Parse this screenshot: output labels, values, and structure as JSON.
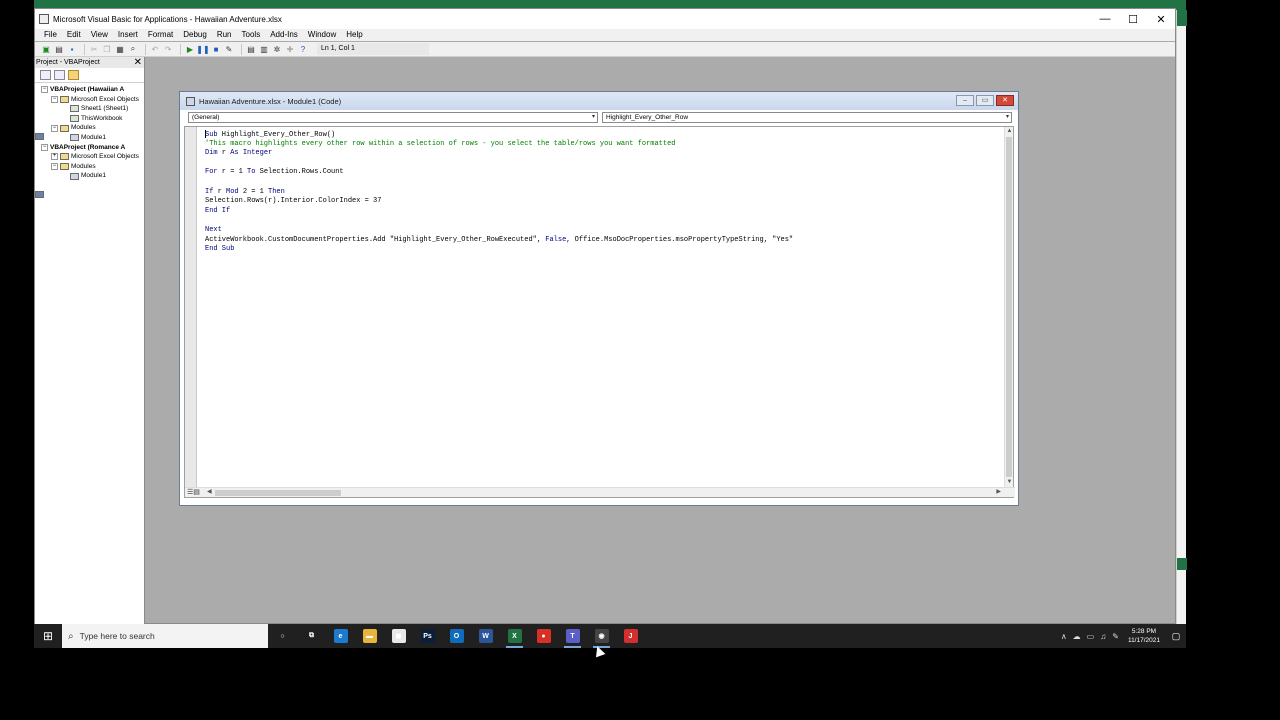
{
  "window": {
    "title": "Microsoft Visual Basic for Applications - Hawaiian Adventure.xlsx",
    "minimize": "—",
    "maximize": "☐",
    "close": "✕"
  },
  "menu": [
    "File",
    "Edit",
    "View",
    "Insert",
    "Format",
    "Debug",
    "Run",
    "Tools",
    "Add-Ins",
    "Window",
    "Help"
  ],
  "toolbar": {
    "position": "Ln 1, Col 1"
  },
  "project": {
    "header": "Project - VBAProject",
    "close": "✕",
    "tree": [
      {
        "label": "VBAProject (Hawaiian A",
        "bold": true,
        "level": 0,
        "icon": "project-icon",
        "exp": "−"
      },
      {
        "label": "Microsoft Excel Objects",
        "level": 1,
        "icon": "folder-icon",
        "exp": "−"
      },
      {
        "label": "Sheet1 (Sheet1)",
        "level": 2,
        "icon": "sheet-icon"
      },
      {
        "label": "ThisWorkbook",
        "level": 2,
        "icon": "workbook-icon"
      },
      {
        "label": "Modules",
        "level": 1,
        "icon": "folder-icon",
        "exp": "−"
      },
      {
        "label": "Module1",
        "level": 2,
        "icon": "module-icon"
      },
      {
        "label": "VBAProject (Romance A",
        "bold": true,
        "level": 0,
        "icon": "project-icon",
        "exp": "−"
      },
      {
        "label": "Microsoft Excel Objects",
        "level": 1,
        "icon": "folder-icon",
        "exp": "+"
      },
      {
        "label": "Modules",
        "level": 1,
        "icon": "folder-icon",
        "exp": "−"
      },
      {
        "label": "Module1",
        "level": 2,
        "icon": "module-icon"
      }
    ]
  },
  "code_window": {
    "title": "Hawaiian Adventure.xlsx - Module1 (Code)",
    "object_combo": "(General)",
    "proc_combo": "Highlight_Every_Other_Row",
    "lines": [
      [
        {
          "t": "kw",
          "v": "Sub"
        },
        {
          "t": "n",
          "v": " Highlight_Every_Other_Row()"
        }
      ],
      [
        {
          "t": "cm",
          "v": "'This macro highlights every other row within a selection of rows - you select the table/rows you want formatted"
        }
      ],
      [
        {
          "t": "kw",
          "v": "Dim"
        },
        {
          "t": "n",
          "v": " r "
        },
        {
          "t": "kw",
          "v": "As"
        },
        {
          "t": "n",
          "v": " "
        },
        {
          "t": "kw",
          "v": "Integer"
        }
      ],
      [],
      [
        {
          "t": "kw",
          "v": "For"
        },
        {
          "t": "n",
          "v": " r = 1 "
        },
        {
          "t": "kw",
          "v": "To"
        },
        {
          "t": "n",
          "v": " Selection.Rows.Count"
        }
      ],
      [],
      [
        {
          "t": "kw",
          "v": "If"
        },
        {
          "t": "n",
          "v": " r "
        },
        {
          "t": "kw",
          "v": "Mod"
        },
        {
          "t": "n",
          "v": " 2 = 1 "
        },
        {
          "t": "kw",
          "v": "Then"
        }
      ],
      [
        {
          "t": "n",
          "v": "Selection.Rows(r).Interior.ColorIndex = 37"
        }
      ],
      [
        {
          "t": "kw",
          "v": "End If"
        }
      ],
      [],
      [
        {
          "t": "kw",
          "v": "Next"
        }
      ],
      [
        {
          "t": "n",
          "v": "ActiveWorkbook.CustomDocumentProperties.Add \"Highlight_Every_Other_RowExecuted\", "
        },
        {
          "t": "kw",
          "v": "False"
        },
        {
          "t": "n",
          "v": ", Office.MsoDocProperties.msoPropertyTypeString, \"Yes\""
        }
      ],
      [
        {
          "t": "kw",
          "v": "End Sub"
        }
      ]
    ]
  },
  "taskbar": {
    "search_placeholder": "Type here to search",
    "apps": [
      {
        "name": "cortana",
        "glyph": "○",
        "color": "#202020"
      },
      {
        "name": "task-view",
        "glyph": "⧉",
        "color": "#202020"
      },
      {
        "name": "edge",
        "glyph": "e",
        "color": "#1b7bd1"
      },
      {
        "name": "file-explorer",
        "glyph": "▬",
        "color": "#e8b43a"
      },
      {
        "name": "store",
        "glyph": "◼",
        "color": "#e8e8e8"
      },
      {
        "name": "photoshop",
        "glyph": "Ps",
        "color": "#0b1f3a"
      },
      {
        "name": "outlook",
        "glyph": "O",
        "color": "#0f6cbd"
      },
      {
        "name": "word",
        "glyph": "W",
        "color": "#2b579a"
      },
      {
        "name": "excel",
        "glyph": "X",
        "color": "#217346",
        "active": true
      },
      {
        "name": "chrome",
        "glyph": "●",
        "color": "#d93025"
      },
      {
        "name": "teams",
        "glyph": "T",
        "color": "#5b5fc7",
        "active": true
      },
      {
        "name": "obs",
        "glyph": "◉",
        "color": "#444444",
        "active": true
      },
      {
        "name": "recorder",
        "glyph": "J",
        "color": "#d32f2f"
      }
    ],
    "time": "5:28 PM",
    "date": "11/17/2021"
  }
}
